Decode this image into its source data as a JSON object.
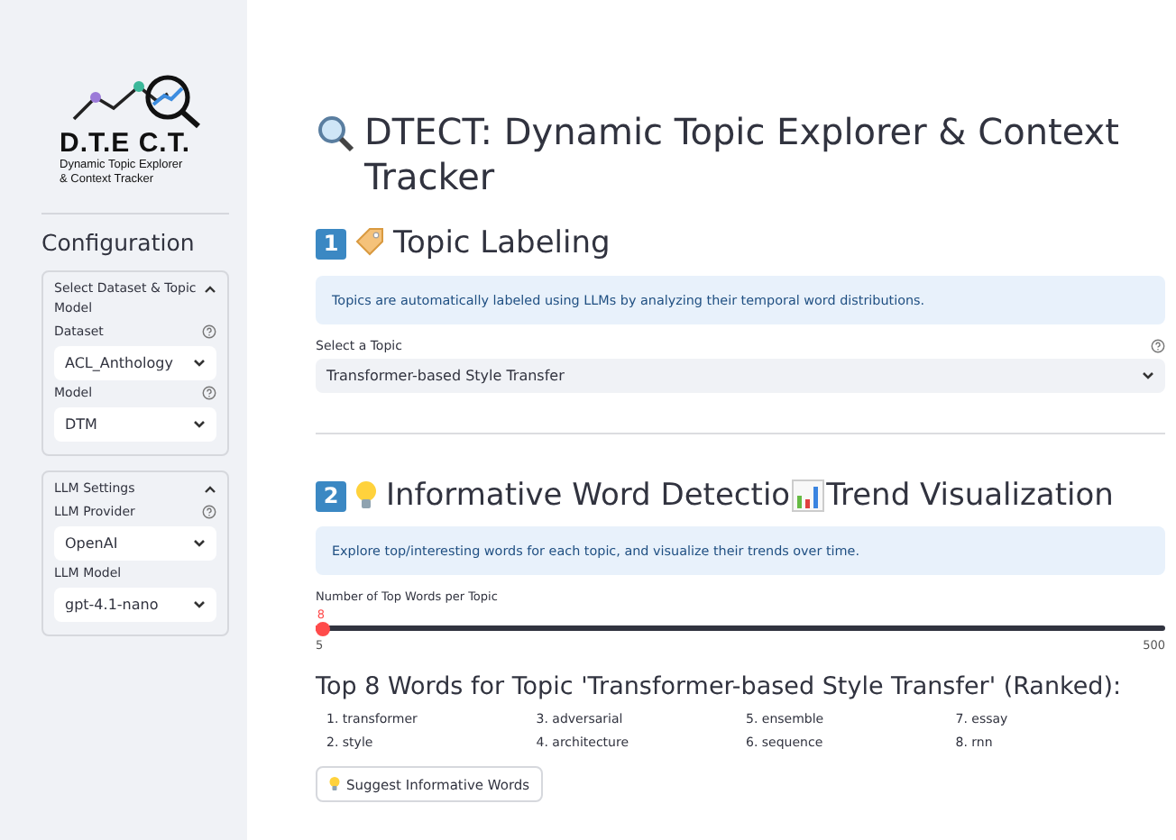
{
  "sidebar": {
    "logo": {
      "wordmark": "D.T.E C.T.",
      "tagline": "Dynamic Topic Explorer & Context Tracker"
    },
    "heading": "Configuration",
    "sections": [
      {
        "title": "Select Dataset & Topic Model",
        "expanded": true,
        "fields": [
          {
            "label": "Dataset",
            "help": true,
            "value": "ACL_Anthology"
          },
          {
            "label": "Model",
            "help": true,
            "value": "DTM"
          }
        ]
      },
      {
        "title": "LLM Settings",
        "expanded": true,
        "fields": [
          {
            "label": "LLM Provider",
            "help": true,
            "value": "OpenAI"
          },
          {
            "label": "LLM Model",
            "help": false,
            "value": "gpt-4.1-nano"
          }
        ]
      }
    ]
  },
  "main": {
    "title": "DTECT: Dynamic Topic Explorer & Context Tracker",
    "section_1": {
      "badge": "1",
      "heading": "Topic Labeling",
      "info": "Topics are automatically labeled using LLMs by analyzing their temporal word distributions.",
      "select": {
        "label": "Select a Topic",
        "value": "Transformer-based Style Transfer"
      }
    },
    "section_2": {
      "badge": "2",
      "heading_start": "Informative Word Detectio",
      "heading_end": "Trend Visualization",
      "info": "Explore top/interesting words for each topic, and visualize their trends over time.",
      "slider": {
        "label": "Number of Top Words per Topic",
        "value": "8",
        "level": 0.006,
        "min": "5",
        "max": "500"
      },
      "words_heading": "Top 8 Words for Topic 'Transformer-based Style Transfer' (Ranked):",
      "words": [
        "1. transformer",
        "2. style",
        "3. adversarial",
        "4. architecture",
        "5. ensemble",
        "6. sequence",
        "7. essay",
        "8. rnn"
      ],
      "button": "Suggest Informative Words"
    }
  }
}
